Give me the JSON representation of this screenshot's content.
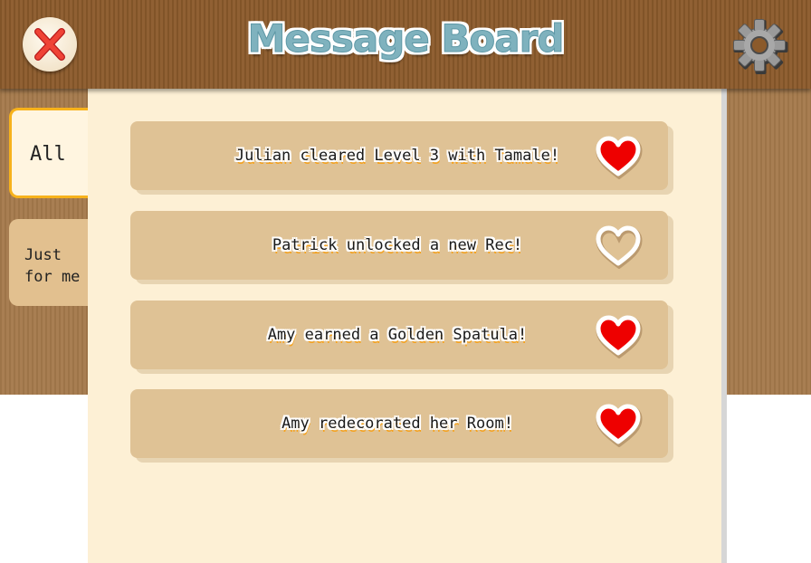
{
  "header": {
    "title": "Message Board",
    "close_icon": "close-x-icon",
    "settings_icon": "gear-icon",
    "title_color": "#7fb2be"
  },
  "tabs": [
    {
      "label": "All",
      "selected": true
    },
    {
      "label": "Just\nfor me",
      "selected": false
    }
  ],
  "messages": [
    {
      "text": "Julian cleared Level 3 with Tamale!",
      "liked": true
    },
    {
      "text": "Patrick unlocked a new Rec!",
      "liked": false
    },
    {
      "text": "Amy earned a Golden Spatula!",
      "liked": true
    },
    {
      "text": "Amy redecorated her Room!",
      "liked": true
    }
  ],
  "colors": {
    "heart_filled": "#ee0000",
    "tab_border": "#f7b21b",
    "text_outline": "#f7a21b",
    "panel": "#fdf0d5",
    "card": "#dfc295"
  }
}
